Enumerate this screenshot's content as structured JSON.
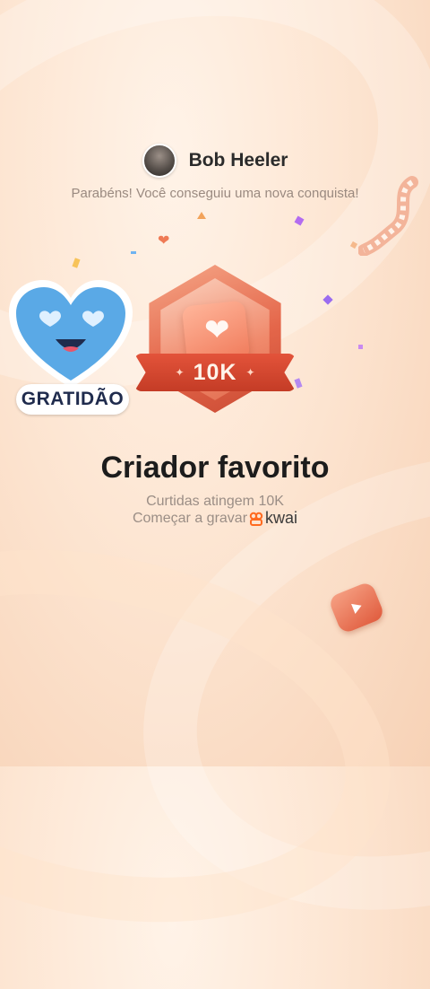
{
  "user": {
    "name": "Bob Heeler"
  },
  "header": {
    "congrats": "Parabéns! Você conseguiu uma nova conquista!"
  },
  "badge": {
    "value_label": "10K",
    "icon": "heart-icon"
  },
  "sticker": {
    "label": "GRATIDÃO",
    "icon": "heart-eyes-emoji"
  },
  "achievement": {
    "title": "Criador favorito",
    "line1": "Curtidas atingem 10K",
    "line2": "Começar a gravar",
    "brand": "kwai"
  },
  "colors": {
    "accent": "#e4664a",
    "ribbon": "#c94a33",
    "kwai_orange": "#ff6a1f",
    "sticker_blue": "#5aa9e6"
  }
}
